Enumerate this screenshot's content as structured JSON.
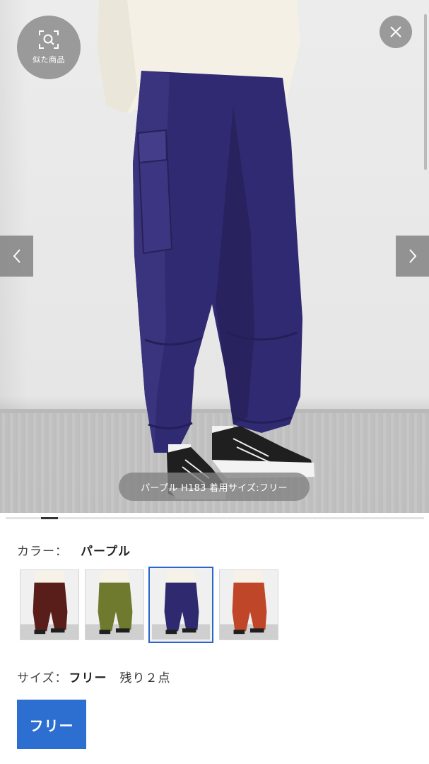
{
  "viewer": {
    "similar_label": "似た商品",
    "caption": "パープル H183 着用サイズ:フリー",
    "progress": 0.04
  },
  "colors": {
    "label": "カラー：",
    "selected": "パープル",
    "swatches": [
      {
        "name": "brown",
        "pants": "#5a1e1a",
        "selected": false
      },
      {
        "name": "olive",
        "pants": "#6f7a2e",
        "selected": false
      },
      {
        "name": "purple",
        "pants": "#2f2a70",
        "selected": true
      },
      {
        "name": "orange",
        "pants": "#c0462a",
        "selected": false
      }
    ]
  },
  "size": {
    "label": "サイズ：",
    "value": "フリー",
    "stock": "残り２点",
    "button_label": "フリー"
  },
  "theme": {
    "accent": "#2d6fd1",
    "pants_main": "#302a72"
  }
}
